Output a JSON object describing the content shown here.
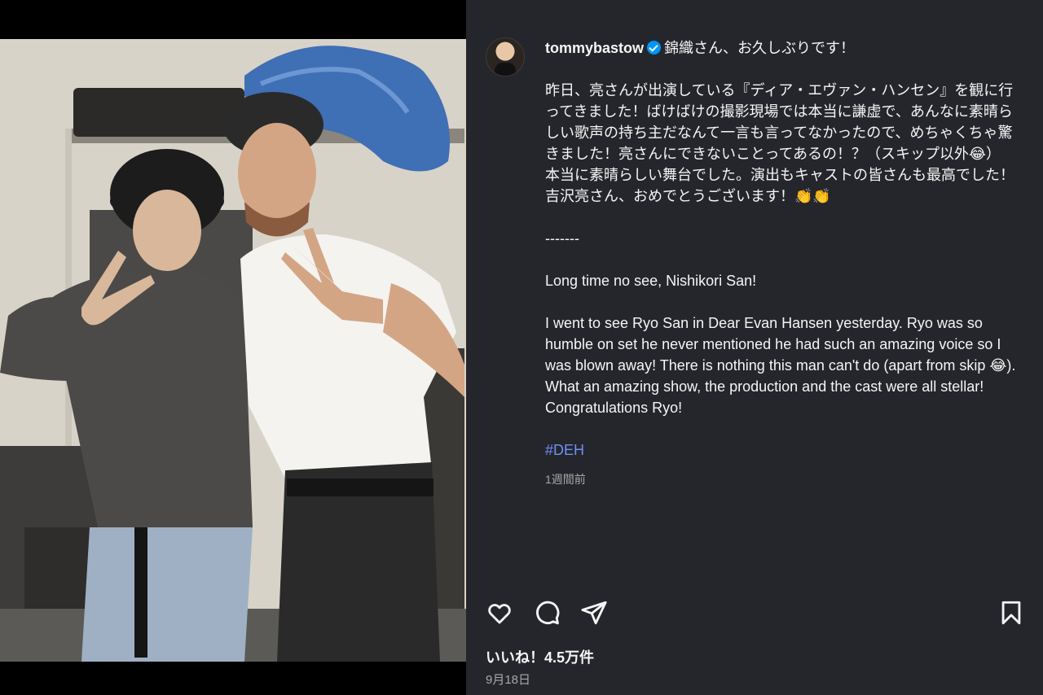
{
  "post": {
    "username": "tommybastow",
    "verified": true,
    "accent_color": "#0095f6",
    "hashtag_color": "#6f8ff5",
    "caption_lines": [
      "錦織さん、お久しぶりです！",
      "",
      "昨日、亮さんが出演している『ディア・エヴァン・ハンセン』を観に行ってきました！ばけばけの撮影現場では本当に謙虚で、あんなに素晴らしい歌声の持ち主だなんて一言も言ってなかったので、めちゃくちゃ驚きました！亮さんにできないことってあるの！？（スキップ以外😂）",
      "本当に素晴らしい舞台でした。演出もキャストの皆さんも最高でした！吉沢亮さん、おめでとうございます！👏👏",
      "",
      "-------",
      "",
      "Long time no see, Nishikori San!",
      "",
      "I went to see Ryo San in Dear Evan Hansen yesterday. Ryo was so humble on set he never mentioned he had such an amazing voice so I was blown away! There is nothing this man can't do (apart from skip 😂). What an amazing show, the production and the cast were all stellar! Congratulations Ryo!",
      ""
    ],
    "hashtag": "#DEH",
    "caption_time": "1週間前",
    "likes_label": "いいね！4.5万件",
    "date_label": "9月18日"
  },
  "icons": {
    "like": "heart-icon",
    "comment": "comment-icon",
    "share": "send-icon",
    "save": "bookmark-icon"
  }
}
